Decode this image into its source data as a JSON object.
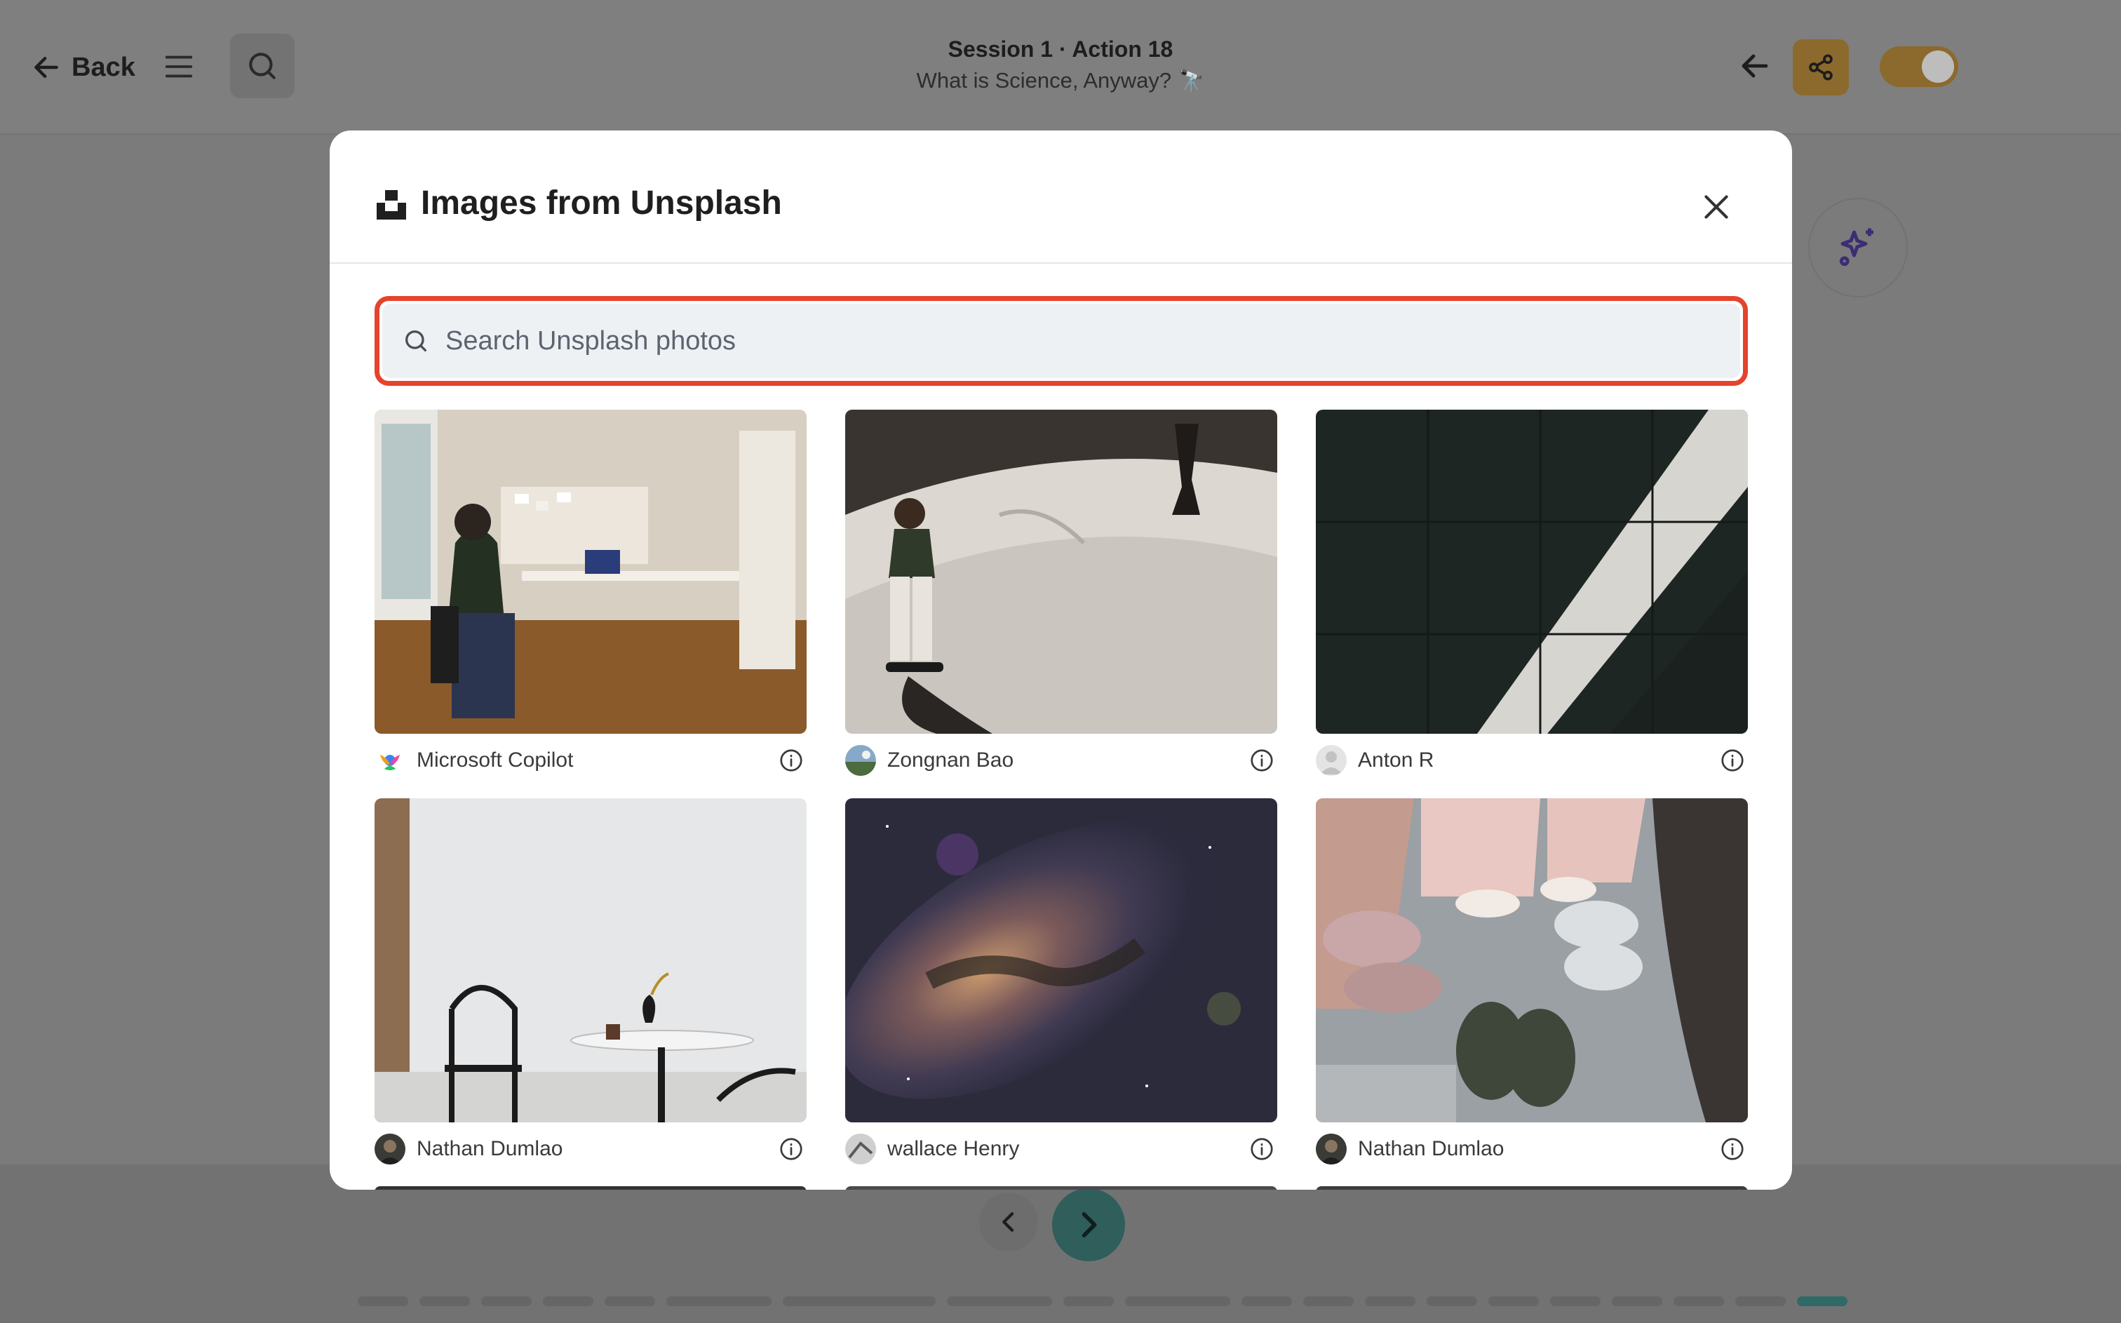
{
  "topbar": {
    "back_label": "Back",
    "session_title": "Session 1 · Action 18",
    "session_subtitle": "What is Science, Anyway? 🔭"
  },
  "modal": {
    "title": "Images from Unsplash",
    "search_placeholder": "Search Unsplash photos",
    "search_value": "",
    "photos": [
      {
        "author": "Microsoft Copilot"
      },
      {
        "author": "Zongnan Bao"
      },
      {
        "author": "Anton R"
      },
      {
        "author": "Nathan Dumlao"
      },
      {
        "author": "wallace Henry"
      },
      {
        "author": "Nathan Dumlao"
      }
    ]
  },
  "colors": {
    "accent_share": "#c7973f",
    "highlight_border": "#e5432c",
    "next_button": "#3f8a85",
    "sparkle": "#5a3ea8"
  },
  "progress": {
    "total_segments": 20,
    "current_segment": 20
  }
}
